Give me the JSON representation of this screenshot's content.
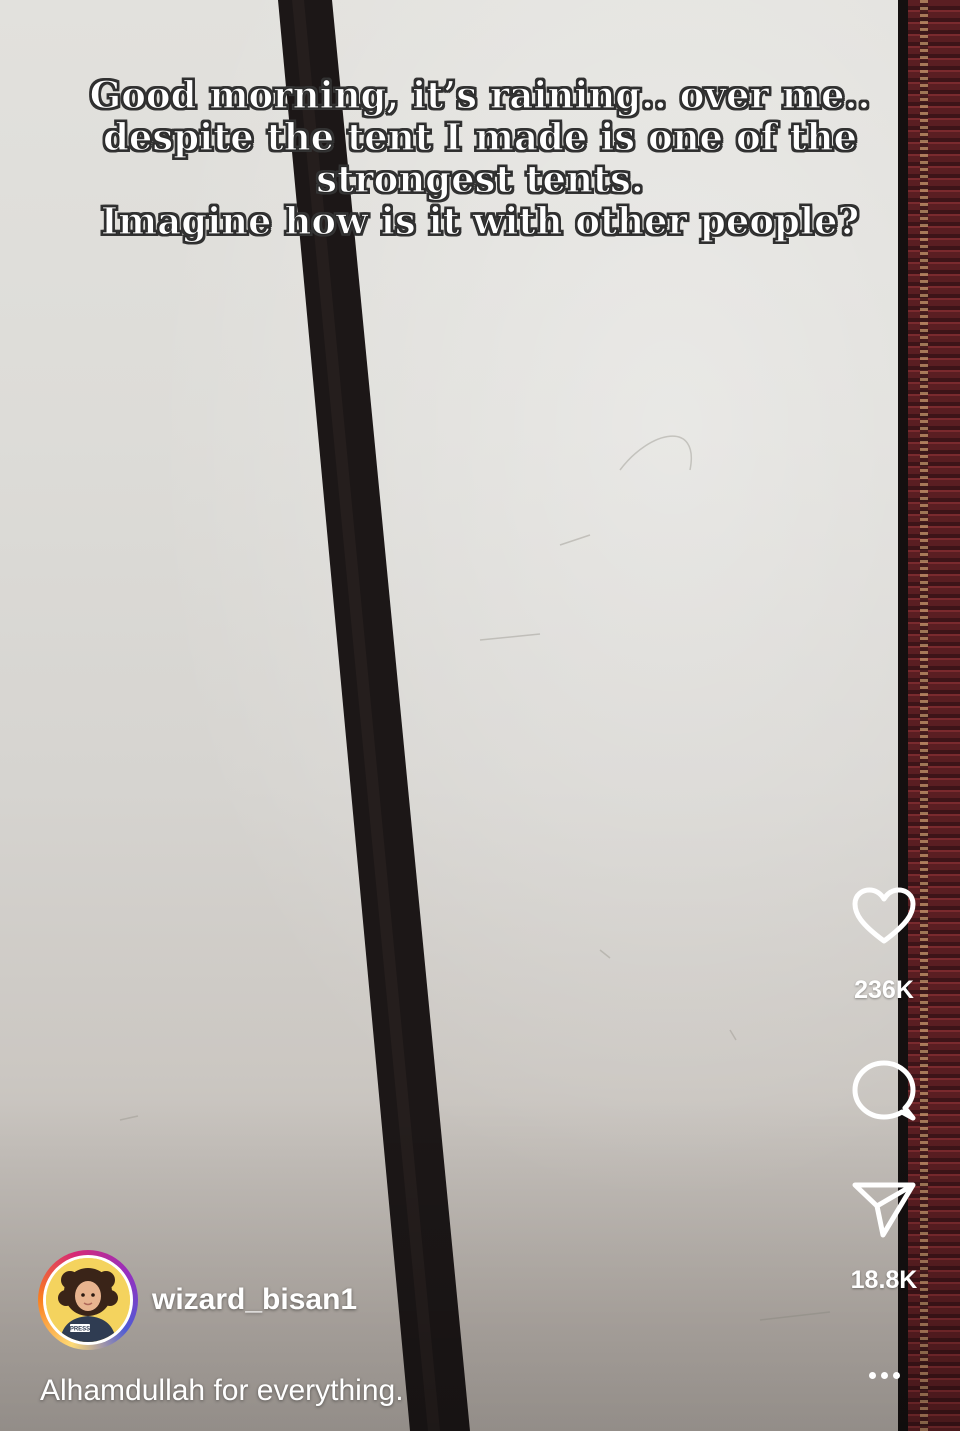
{
  "overlay_caption": {
    "lines": [
      "Good morning, it’s raining.. over me..",
      "despite the tent I made is one of the",
      "strongest tents.",
      "Imagine how is it with other people?"
    ]
  },
  "actions": {
    "like": {
      "icon": "heart-icon",
      "count": "236K"
    },
    "comment": {
      "icon": "comment-bubble-icon"
    },
    "share": {
      "icon": "send-paper-plane-icon",
      "count": "18.8K"
    },
    "more": {
      "icon": "more-options-icon"
    }
  },
  "author": {
    "username": "wizard_bisan1",
    "avatar_badge": "PRESS"
  },
  "post": {
    "description": "Alhamdullah for everything."
  },
  "colors": {
    "overlay_text": "#ffffff",
    "story_ring": [
      "#feda75",
      "#fa7e1e",
      "#d62976",
      "#962fbf",
      "#4f5bd5"
    ]
  }
}
